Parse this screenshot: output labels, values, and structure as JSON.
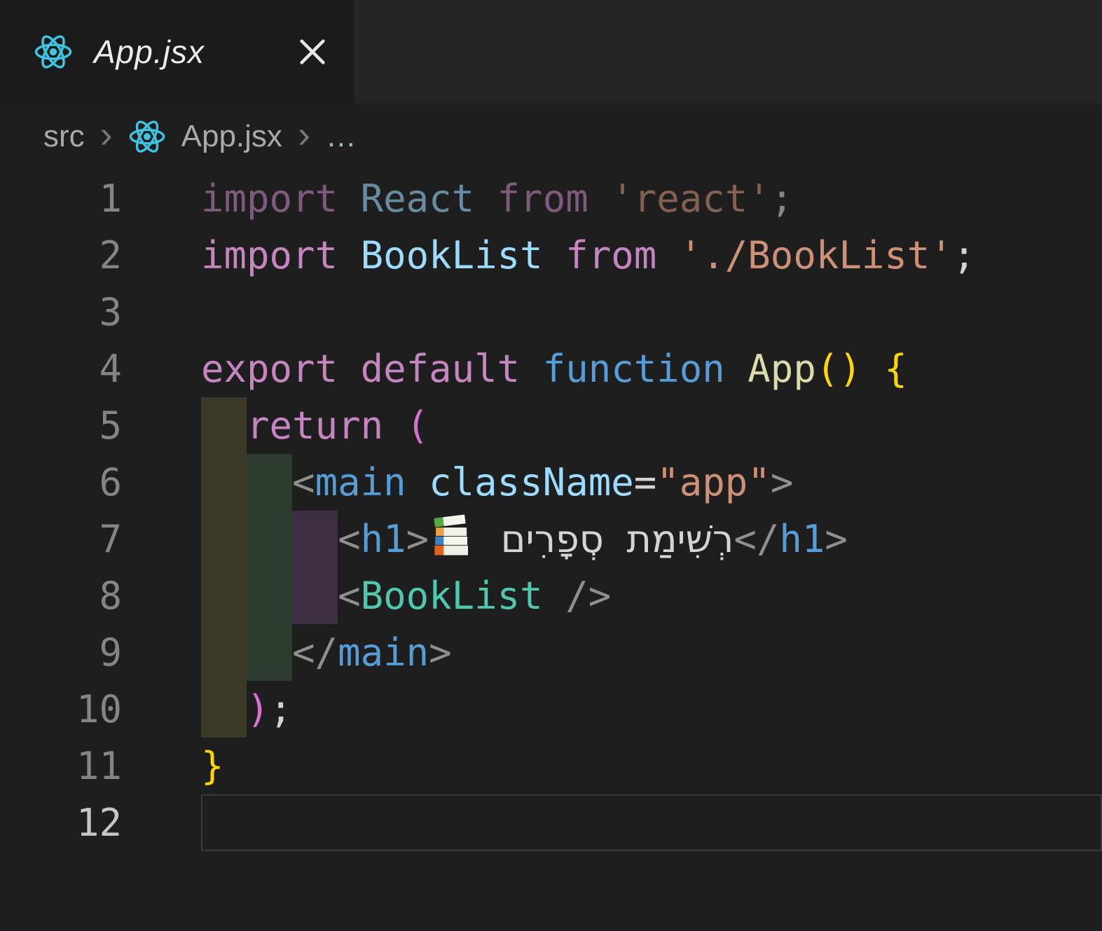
{
  "tab": {
    "title": "App.jsx",
    "icon": "react-logo",
    "close_icon": "✕"
  },
  "breadcrumb": {
    "folder": "src",
    "file": "App.jsx",
    "file_icon": "react-logo",
    "symbol": "…",
    "separator": "›"
  },
  "colors": {
    "editor_bg": "#1e1e1f",
    "tabbar_bg": "#252526",
    "tab_bg": "#1b1b1c",
    "react_cyan": "#3ec5e2",
    "line_number": "#858585",
    "line_number_active": "#c6c6c6",
    "current_line_border": "#3a3a3d",
    "indent": [
      "#3b3a28",
      "#2d3a2e",
      "#3e2e44"
    ],
    "tokens": {
      "kw": "#C586C0",
      "blue": "#569CD6",
      "var": "#9CDCFE",
      "str": "#CE9178",
      "fn": "#DCDCAA",
      "comp": "#4EC9B0",
      "punct": "#8f8f8f",
      "fg": "#d4d4d4",
      "b1": "#ffd700",
      "b2": "#da70d6"
    }
  },
  "editor": {
    "books_emoji": "📚",
    "lines": [
      {
        "n": "1",
        "faded": true,
        "indent": [],
        "tokens": [
          {
            "t": "import",
            "c": "kw"
          },
          {
            "t": " ",
            "c": "fg"
          },
          {
            "t": "React",
            "c": "var"
          },
          {
            "t": " ",
            "c": "fg"
          },
          {
            "t": "from",
            "c": "kw"
          },
          {
            "t": " ",
            "c": "fg"
          },
          {
            "t": "'react'",
            "c": "str"
          },
          {
            "t": ";",
            "c": "fg"
          }
        ]
      },
      {
        "n": "2",
        "indent": [],
        "tokens": [
          {
            "t": "import",
            "c": "kw"
          },
          {
            "t": " ",
            "c": "fg"
          },
          {
            "t": "BookList",
            "c": "var"
          },
          {
            "t": " ",
            "c": "fg"
          },
          {
            "t": "from",
            "c": "kw"
          },
          {
            "t": " ",
            "c": "fg"
          },
          {
            "t": "'./BookList'",
            "c": "str"
          },
          {
            "t": ";",
            "c": "fg"
          }
        ]
      },
      {
        "n": "3",
        "indent": [],
        "tokens": []
      },
      {
        "n": "4",
        "indent": [],
        "tokens": [
          {
            "t": "export",
            "c": "kw"
          },
          {
            "t": " ",
            "c": "fg"
          },
          {
            "t": "default",
            "c": "kw"
          },
          {
            "t": " ",
            "c": "fg"
          },
          {
            "t": "function",
            "c": "blue"
          },
          {
            "t": " ",
            "c": "fg"
          },
          {
            "t": "App",
            "c": "fn"
          },
          {
            "t": "()",
            "c": "b1"
          },
          {
            "t": " ",
            "c": "fg"
          },
          {
            "t": "{",
            "c": "b1"
          }
        ]
      },
      {
        "n": "5",
        "indent": [
          0
        ],
        "tokens": [
          {
            "t": "  ",
            "c": "fg"
          },
          {
            "t": "return",
            "c": "kw"
          },
          {
            "t": " ",
            "c": "fg"
          },
          {
            "t": "(",
            "c": "b2"
          }
        ]
      },
      {
        "n": "6",
        "indent": [
          0,
          1
        ],
        "tokens": [
          {
            "t": "    ",
            "c": "fg"
          },
          {
            "t": "<",
            "c": "punct"
          },
          {
            "t": "main",
            "c": "blue"
          },
          {
            "t": " ",
            "c": "fg"
          },
          {
            "t": "className",
            "c": "var"
          },
          {
            "t": "=",
            "c": "fg"
          },
          {
            "t": "\"app\"",
            "c": "str"
          },
          {
            "t": ">",
            "c": "punct"
          }
        ]
      },
      {
        "n": "7",
        "indent": [
          0,
          1,
          2
        ],
        "tokens": [
          {
            "t": "      ",
            "c": "fg"
          },
          {
            "t": "<",
            "c": "punct"
          },
          {
            "t": "h1",
            "c": "blue"
          },
          {
            "t": ">",
            "c": "punct"
          },
          {
            "icon": "books-emoji"
          },
          {
            "t": " ",
            "c": "fg"
          },
          {
            "t": "רְשִׁימַת סְפָרִים",
            "c": "fg",
            "name": "hebrew-title-text"
          },
          {
            "t": "</",
            "c": "punct"
          },
          {
            "t": "h1",
            "c": "blue"
          },
          {
            "t": ">",
            "c": "punct"
          }
        ]
      },
      {
        "n": "8",
        "indent": [
          0,
          1,
          2
        ],
        "tokens": [
          {
            "t": "      ",
            "c": "fg"
          },
          {
            "t": "<",
            "c": "punct"
          },
          {
            "t": "BookList",
            "c": "comp"
          },
          {
            "t": " ",
            "c": "fg"
          },
          {
            "t": "/>",
            "c": "punct"
          }
        ]
      },
      {
        "n": "9",
        "indent": [
          0,
          1
        ],
        "tokens": [
          {
            "t": "    ",
            "c": "fg"
          },
          {
            "t": "</",
            "c": "punct"
          },
          {
            "t": "main",
            "c": "blue"
          },
          {
            "t": ">",
            "c": "punct"
          }
        ]
      },
      {
        "n": "10",
        "indent": [
          0
        ],
        "tokens": [
          {
            "t": "  ",
            "c": "fg"
          },
          {
            "t": ")",
            "c": "b2"
          },
          {
            "t": ";",
            "c": "fg"
          }
        ]
      },
      {
        "n": "11",
        "indent": [],
        "tokens": [
          {
            "t": "}",
            "c": "b1"
          }
        ]
      },
      {
        "n": "12",
        "indent": [],
        "current": true,
        "tokens": []
      }
    ]
  }
}
